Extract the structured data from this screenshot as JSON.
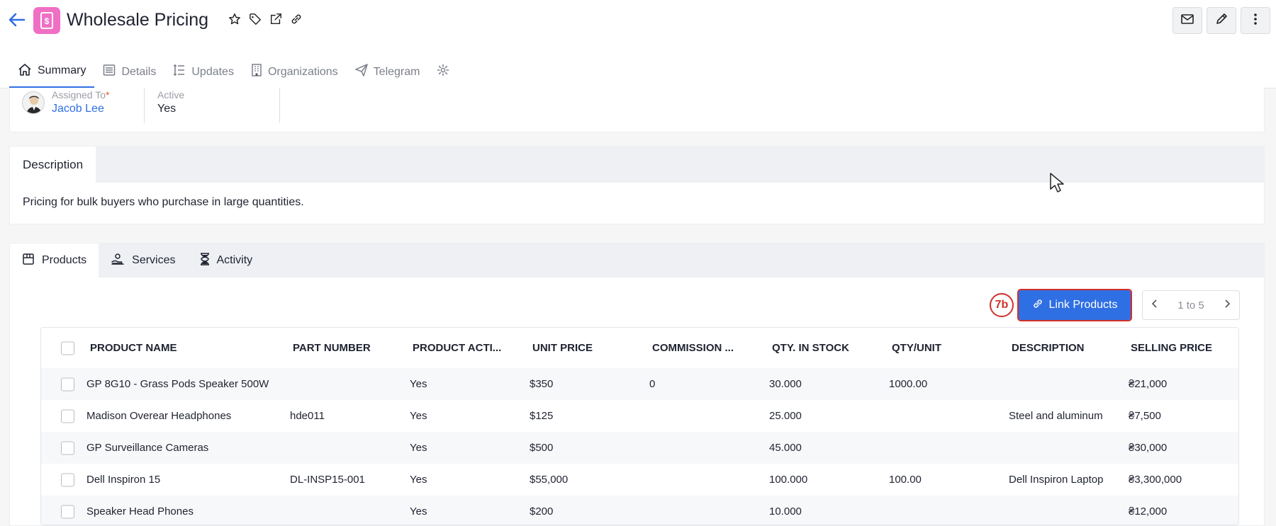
{
  "header": {
    "title": "Wholesale Pricing",
    "module_icon": "dollar-document-icon",
    "icons": [
      "star-icon",
      "tag-icon",
      "external-link-icon",
      "link-icon"
    ],
    "right_buttons": [
      "mail-icon",
      "pencil-icon",
      "more-vertical-icon"
    ]
  },
  "tabs": [
    {
      "label": "Summary",
      "icon": "home-icon",
      "active": true
    },
    {
      "label": "Details",
      "icon": "list-icon"
    },
    {
      "label": "Updates",
      "icon": "timeline-icon"
    },
    {
      "label": "Organizations",
      "icon": "building-icon"
    },
    {
      "label": "Telegram",
      "icon": "send-icon"
    },
    {
      "label": "",
      "icon": "gear-icon"
    }
  ],
  "summary": {
    "assigned_label": "Assigned To",
    "assigned_required": "*",
    "assigned_value": "Jacob Lee",
    "active_label": "Active",
    "active_value": "Yes"
  },
  "description": {
    "tab_label": "Description",
    "text": "Pricing for bulk buyers who purchase in large quantities."
  },
  "related_tabs": [
    {
      "label": "Products",
      "icon": "box-icon",
      "active": true
    },
    {
      "label": "Services",
      "icon": "service-hand-icon"
    },
    {
      "label": "Activity",
      "icon": "hourglass-icon"
    }
  ],
  "annotation_badge": "7b",
  "link_button_label": "Link Products",
  "pager_label": "1 to 5",
  "table": {
    "columns": [
      "PRODUCT NAME",
      "PART NUMBER",
      "PRODUCT ACTI...",
      "UNIT PRICE",
      "COMMISSION ...",
      "QTY. IN STOCK",
      "QTY/UNIT",
      "DESCRIPTION",
      "SELLING PRICE"
    ],
    "rows": [
      [
        "GP 8G10 - Grass Pods Speaker 500W",
        "",
        "Yes",
        "$350",
        "0",
        "30.000",
        "1000.00",
        "",
        "₴21,000"
      ],
      [
        "Madison Overear Headphones",
        "hde011",
        "Yes",
        "$125",
        "",
        "25.000",
        "",
        "Steel and aluminum",
        "₴7,500"
      ],
      [
        "GP Surveillance Cameras",
        "",
        "Yes",
        "$500",
        "",
        "45.000",
        "",
        "",
        "₴30,000"
      ],
      [
        "Dell Inspiron 15",
        "DL-INSP15-001",
        "Yes",
        "$55,000",
        "",
        "100.000",
        "100.00",
        "Dell Inspiron Laptop",
        "₴3,300,000"
      ],
      [
        "Speaker Head Phones",
        "",
        "Yes",
        "$200",
        "",
        "10.000",
        "",
        "",
        "₴12,000"
      ]
    ]
  },
  "colors": {
    "accent": "#2f6fe4",
    "module_icon_bg": "#f06fc4",
    "annotation": "#d0302a"
  }
}
